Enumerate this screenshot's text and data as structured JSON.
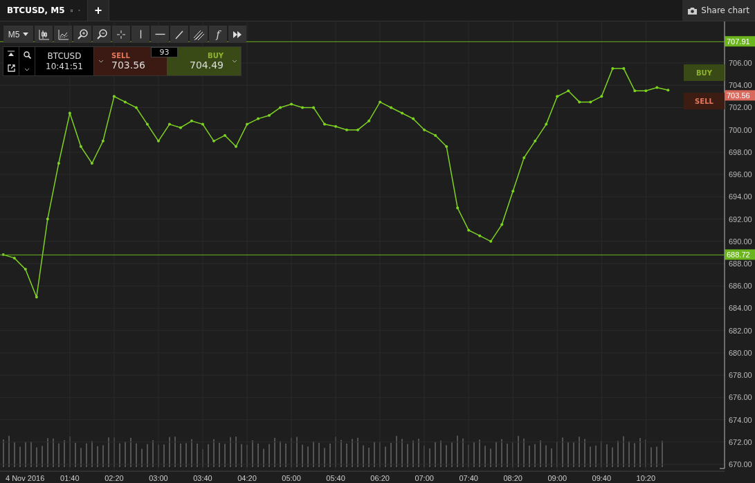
{
  "tabs": [
    {
      "label": "BTCUSD, M5",
      "selected": true
    }
  ],
  "new_tab": "+",
  "share_button": {
    "label": "Share chart"
  },
  "toolbar": {
    "timeframe": "M5",
    "tools": [
      {
        "kind": "candles"
      },
      {
        "kind": "indicators"
      },
      {
        "kind": "zoom-in"
      },
      {
        "kind": "zoom-out"
      },
      {
        "kind": "crosshair"
      },
      {
        "kind": "vertical-line"
      },
      {
        "kind": "horizontal-line"
      },
      {
        "kind": "trend-line"
      },
      {
        "kind": "channel"
      },
      {
        "kind": "function",
        "label": "f"
      },
      {
        "kind": "more"
      }
    ]
  },
  "trade_panel": {
    "symbol": "BTCUSD",
    "time": "10:41:51",
    "sell": {
      "label": "SELL",
      "price": "703.56"
    },
    "spread": "93",
    "buy": {
      "label": "BUY",
      "price": "704.49"
    }
  },
  "side_buttons": [
    {
      "kind": "buy",
      "label": "BUY"
    },
    {
      "kind": "sell",
      "label": "SELL"
    }
  ],
  "price_tags": [
    {
      "kind": "high",
      "label": "707.91"
    },
    {
      "kind": "bid",
      "label": "703.56"
    },
    {
      "kind": "low",
      "label": "688.72"
    }
  ],
  "chart": {
    "date_label": "4 Nov 2016",
    "chart_data": {
      "type": "line",
      "grid": true,
      "ylim": [
        670,
        709.7
      ],
      "xlim": [
        37,
        691
      ],
      "yticks": [
        {
          "value": 670,
          "label": "670.00"
        },
        {
          "value": 672,
          "label": "672.00"
        },
        {
          "value": 674,
          "label": "674.00"
        },
        {
          "value": 676,
          "label": "676.00"
        },
        {
          "value": 678,
          "label": "678.00"
        },
        {
          "value": 680,
          "label": "680.00"
        },
        {
          "value": 682,
          "label": "682.00"
        },
        {
          "value": 684,
          "label": "684.00"
        },
        {
          "value": 686,
          "label": "686.00"
        },
        {
          "value": 688,
          "label": "688.00"
        },
        {
          "value": 690,
          "label": "690.00"
        },
        {
          "value": 692,
          "label": "692.00"
        },
        {
          "value": 694,
          "label": "694.00"
        },
        {
          "value": 696,
          "label": "696.00"
        },
        {
          "value": 698,
          "label": "698.00"
        },
        {
          "value": 700,
          "label": "700.00"
        },
        {
          "value": 702,
          "label": "702.00"
        },
        {
          "value": 704,
          "label": "704.00"
        },
        {
          "value": 706,
          "label": "706.00"
        }
      ],
      "xticks": [
        {
          "value": 100,
          "label": "01:40"
        },
        {
          "value": 140,
          "label": "02:20"
        },
        {
          "value": 180,
          "label": "03:00"
        },
        {
          "value": 220,
          "label": "03:40"
        },
        {
          "value": 260,
          "label": "04:20"
        },
        {
          "value": 300,
          "label": "05:00"
        },
        {
          "value": 340,
          "label": "05:40"
        },
        {
          "value": 380,
          "label": "06:20"
        },
        {
          "value": 420,
          "label": "07:00"
        },
        {
          "value": 460,
          "label": "07:40"
        },
        {
          "value": 500,
          "label": "08:20"
        },
        {
          "value": 540,
          "label": "09:00"
        },
        {
          "value": 580,
          "label": "09:40"
        },
        {
          "value": 620,
          "label": "10:20"
        }
      ],
      "x": [
        40,
        50,
        60,
        70,
        80,
        90,
        100,
        110,
        120,
        130,
        140,
        150,
        160,
        170,
        180,
        190,
        200,
        210,
        220,
        230,
        240,
        250,
        260,
        270,
        280,
        290,
        300,
        310,
        320,
        330,
        340,
        350,
        360,
        370,
        380,
        390,
        400,
        410,
        420,
        430,
        440,
        450,
        460,
        470,
        480,
        490,
        500,
        510,
        520,
        530,
        540,
        550,
        560,
        570,
        580,
        590,
        600,
        610,
        620,
        630,
        640
      ],
      "values": [
        688.8,
        688.5,
        687.5,
        685,
        692,
        697,
        701.5,
        698.5,
        697,
        699,
        703,
        702.5,
        702,
        700.5,
        699,
        700.5,
        700.2,
        700.8,
        700.5,
        699,
        699.5,
        698.5,
        700.5,
        701,
        701.3,
        702,
        702.3,
        702,
        702,
        700.5,
        700.3,
        700,
        700,
        700.8,
        702.5,
        702,
        701.5,
        701,
        700,
        699.5,
        698.5,
        693,
        691,
        690.5,
        690,
        691.5,
        694.5,
        697.5,
        699,
        700.5,
        703,
        703.5,
        702.5,
        702.5,
        703,
        705.5,
        705.5,
        703.5,
        703.5,
        703.8,
        703.56
      ]
    }
  }
}
